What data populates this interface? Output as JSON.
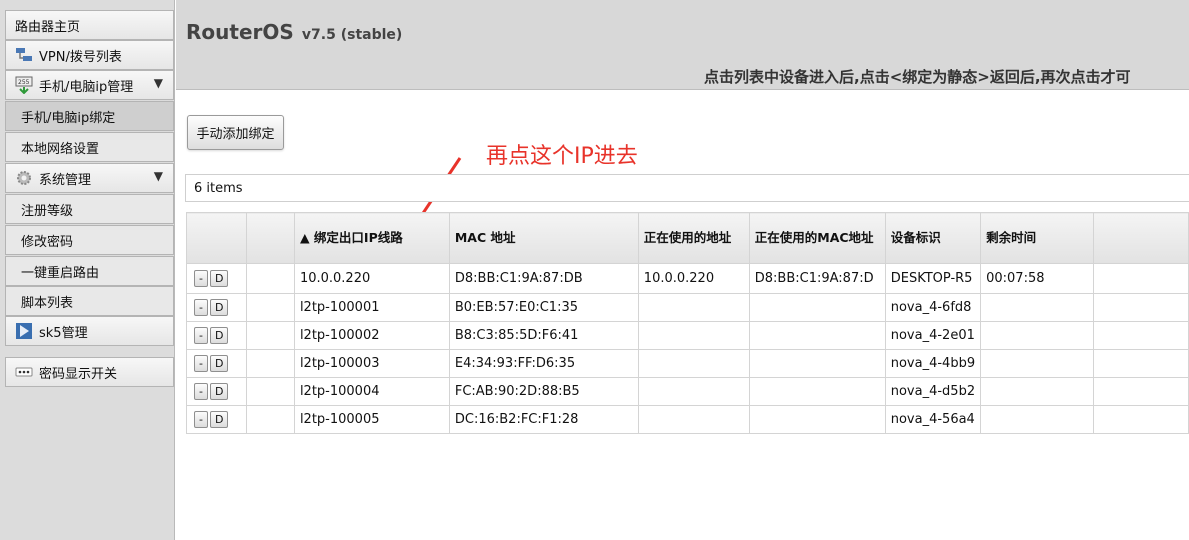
{
  "sidebar": {
    "items": [
      {
        "label": "路由器主页"
      },
      {
        "label": "VPN/拨号列表"
      },
      {
        "label": "手机/电脑ip管理"
      },
      {
        "label": "手机/电脑ip绑定"
      },
      {
        "label": "本地网络设置"
      },
      {
        "label": "系统管理"
      },
      {
        "label": "注册等级"
      },
      {
        "label": "修改密码"
      },
      {
        "label": "一键重启路由"
      },
      {
        "label": "脚本列表"
      },
      {
        "label": "sk5管理"
      },
      {
        "label": "密码显示开关"
      }
    ],
    "expand_arrow": "▼"
  },
  "header": {
    "title": "RouterOS",
    "version": "v7.5 (stable)",
    "notice": "点击列表中设备进入后,点击<绑定为静态>返回后,再次点击才可"
  },
  "toolbar": {
    "add_button": "手动添加绑定"
  },
  "annotation": {
    "text": "再点这个IP进去",
    "color": "#e8332a"
  },
  "list": {
    "count_label": "6 items",
    "sort_indicator": "▲",
    "columns": [
      "绑定出口IP线路",
      "MAC 地址",
      "正在使用的地址",
      "正在使用的MAC地址",
      "设备标识",
      "剩余时间"
    ],
    "row_buttons": [
      "-",
      "D"
    ],
    "rows": [
      {
        "line": "10.0.0.220",
        "mac": "D8:BB:C1:9A:87:DB",
        "active_addr": "10.0.0.220",
        "active_mac": "D8:BB:C1:9A:87:D",
        "device": "DESKTOP-R5",
        "remaining": "00:07:58"
      },
      {
        "line": "l2tp-100001",
        "mac": "B0:EB:57:E0:C1:35",
        "active_addr": "",
        "active_mac": "",
        "device": "nova_4-6fd8",
        "remaining": ""
      },
      {
        "line": "l2tp-100002",
        "mac": "B8:C3:85:5D:F6:41",
        "active_addr": "",
        "active_mac": "",
        "device": "nova_4-2e01",
        "remaining": ""
      },
      {
        "line": "l2tp-100003",
        "mac": "E4:34:93:FF:D6:35",
        "active_addr": "",
        "active_mac": "",
        "device": "nova_4-4bb9",
        "remaining": ""
      },
      {
        "line": "l2tp-100004",
        "mac": "FC:AB:90:2D:88:B5",
        "active_addr": "",
        "active_mac": "",
        "device": "nova_4-d5b2",
        "remaining": ""
      },
      {
        "line": "l2tp-100005",
        "mac": "DC:16:B2:FC:F1:28",
        "active_addr": "",
        "active_mac": "",
        "device": "nova_4-56a4",
        "remaining": ""
      }
    ]
  }
}
